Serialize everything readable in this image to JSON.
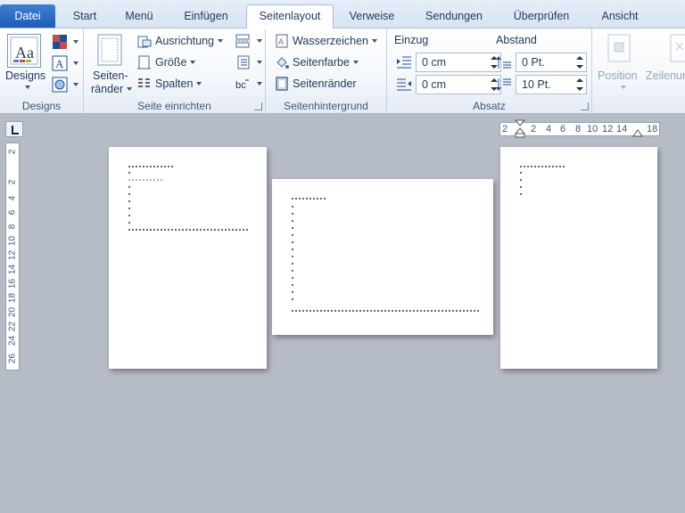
{
  "tabs": [
    {
      "label": "Datei"
    },
    {
      "label": "Start"
    },
    {
      "label": "Menü"
    },
    {
      "label": "Einfügen"
    },
    {
      "label": "Seitenlayout"
    },
    {
      "label": "Verweise"
    },
    {
      "label": "Sendungen"
    },
    {
      "label": "Überprüfen"
    },
    {
      "label": "Ansicht"
    }
  ],
  "active_tab": "Seitenlayout",
  "groups": {
    "designs": {
      "label": "Designs",
      "designs_button": "Designs"
    },
    "seite_einrichten": {
      "label": "Seite einrichten",
      "seitenraender_line1": "Seiten-",
      "seitenraender_line2": "ränder",
      "ausrichtung": "Ausrichtung",
      "groesse": "Größe",
      "spalten": "Spalten"
    },
    "seitenhintergrund": {
      "label": "Seitenhintergrund",
      "wasserzeichen": "Wasserzeichen",
      "seitenfarbe": "Seitenfarbe",
      "seitenraender": "Seitenränder"
    },
    "absatz": {
      "label": "Absatz",
      "einzug_label": "Einzug",
      "abstand_label": "Abstand",
      "einzug_links": "0 cm",
      "einzug_rechts": "0 cm",
      "abstand_vor": "0 Pt.",
      "abstand_nach": "10 Pt."
    },
    "anordnen": {
      "position": "Position",
      "zeilenumbruch": "Zeilenum"
    }
  },
  "hruler": [
    "2",
    "2",
    "4",
    "6",
    "8",
    "10",
    "12",
    "14",
    "18"
  ],
  "vruler": [
    "2",
    "2",
    "4",
    "6",
    "8",
    "10",
    "12",
    "14",
    "16",
    "18",
    "20",
    "22",
    "24",
    "26"
  ],
  "colors": {
    "file_tab": "#2a6bc6",
    "ribbon_bg": "#f4f7fb",
    "workspace_bg": "#b6bcc6",
    "page_bg": "#ffffff"
  }
}
